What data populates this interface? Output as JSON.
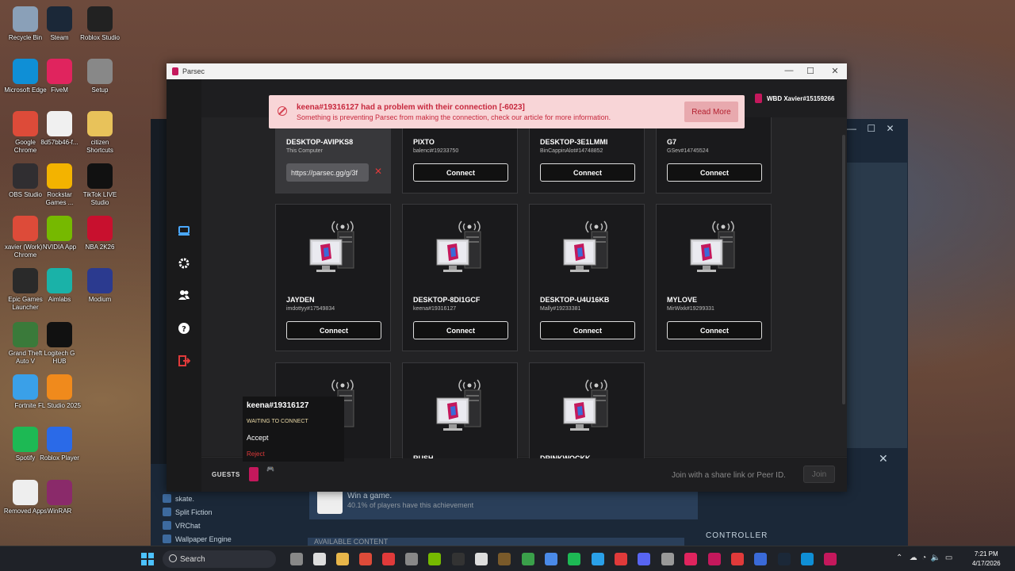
{
  "desktop": {
    "icons": [
      {
        "label": "Recycle Bin",
        "icon": "recycle-bin-icon",
        "color": "#8aa0b8"
      },
      {
        "label": "Steam",
        "icon": "steam-icon",
        "color": "#1b2838"
      },
      {
        "label": "Roblox Studio",
        "icon": "roblox-studio-icon",
        "color": "#222"
      },
      {
        "label": "Microsoft Edge",
        "icon": "edge-icon",
        "color": "#0f8fd6"
      },
      {
        "label": "FiveM",
        "icon": "fivem-icon",
        "color": "#e0245e"
      },
      {
        "label": "Setup",
        "icon": "setup-icon",
        "color": "#888"
      },
      {
        "label": "Google Chrome",
        "icon": "chrome-icon",
        "color": "#dd4b39"
      },
      {
        "label": "8d57bb46-f...",
        "icon": "file-icon",
        "color": "#f0f0f0"
      },
      {
        "label": "citizen Shortcuts",
        "icon": "folder-icon",
        "color": "#e8c25a"
      },
      {
        "label": "OBS Studio",
        "icon": "obs-icon",
        "color": "#302e31"
      },
      {
        "label": "Rockstar Games ...",
        "icon": "rockstar-icon",
        "color": "#f3b300"
      },
      {
        "label": "TikTok LIVE Studio",
        "icon": "tiktok-icon",
        "color": "#111"
      },
      {
        "label": "xavier (Work) - Chrome",
        "icon": "chrome-profile-icon",
        "color": "#dd4b39"
      },
      {
        "label": "NVIDIA App",
        "icon": "nvidia-icon",
        "color": "#76b900"
      },
      {
        "label": "NBA 2K26",
        "icon": "nba2k-icon",
        "color": "#c8102e"
      },
      {
        "label": "Epic Games Launcher",
        "icon": "epic-icon",
        "color": "#2a2a2a"
      },
      {
        "label": "Aimlabs",
        "icon": "aimlabs-icon",
        "color": "#1ab2a8"
      },
      {
        "label": "Modium",
        "icon": "modium-icon",
        "color": "#2b3a8f"
      },
      {
        "label": "Grand Theft Auto V",
        "icon": "gta-icon",
        "color": "#3a7a3a"
      },
      {
        "label": "Logitech G HUB",
        "icon": "logitech-icon",
        "color": "#111"
      },
      {
        "label": "Fortnite",
        "icon": "fortnite-icon",
        "color": "#3aa0e8"
      },
      {
        "label": "FL Studio 2025",
        "icon": "flstudio-icon",
        "color": "#f08a1c"
      },
      {
        "label": "Spotify",
        "icon": "spotify-icon",
        "color": "#1db954"
      },
      {
        "label": "Roblox Player",
        "icon": "roblox-icon",
        "color": "#2a6ae8"
      },
      {
        "label": "Removed Apps",
        "icon": "removed-apps-icon",
        "color": "#eee"
      },
      {
        "label": "WinRAR",
        "icon": "winrar-icon",
        "color": "#8a2a6a"
      }
    ]
  },
  "steam": {
    "list": [
      "skate.",
      "Split Fiction",
      "VRChat",
      "Wallpaper Engine"
    ],
    "achievement": {
      "title": "Win a game.",
      "stat": "40.1% of players have this achievement"
    },
    "available": "AVAILABLE CONTENT",
    "controller": "CONTROLLER"
  },
  "parsec": {
    "title": "Parsec",
    "user": "WBD Xavier#15159266",
    "error": {
      "title": "keena#19316127 had a problem with their connection [-6023]",
      "message": "Something is preventing Parsec from making the connection, check our article for more information.",
      "button": "Read More"
    },
    "self_card": {
      "name": "DESKTOP-AVIPKS8",
      "sub": "This Computer",
      "link": "https://parsec.gg/g/3f"
    },
    "connect_label": "Connect",
    "computers": [
      {
        "name": "PIXTO",
        "owner": "balenci#19233750"
      },
      {
        "name": "DESKTOP-3E1LMMI",
        "owner": "BinCappinAlot#14748852"
      },
      {
        "name": "G7",
        "owner": "GSev#14745524"
      },
      {
        "name": "JAYDEN",
        "owner": "imdottyy#17549834"
      },
      {
        "name": "DESKTOP-8DI1GCF",
        "owner": "keena#19316127"
      },
      {
        "name": "DESKTOP-U4U16KB",
        "owner": "Mally#19233381"
      },
      {
        "name": "MYLOVE",
        "owner": "MirWixk#19299331"
      },
      {
        "name": "",
        "owner": ""
      },
      {
        "name": "RUSH",
        "owner": ""
      },
      {
        "name": "DRINKWOCKK",
        "owner": ""
      }
    ],
    "guest_popup": {
      "name": "keena#19316127",
      "status": "WAITING TO CONNECT",
      "accept": "Accept",
      "reject": "Reject"
    },
    "footer": {
      "guests": "GUESTS",
      "join_placeholder": "Join with a share link or Peer ID.",
      "join_button": "Join"
    },
    "colors": {
      "accent": "#c4185c",
      "error_bg": "#f8d5d7",
      "error_text": "#c7283d"
    }
  },
  "taskbar": {
    "search": "Search",
    "time": "7:21 PM",
    "date": "4/17/2026"
  }
}
